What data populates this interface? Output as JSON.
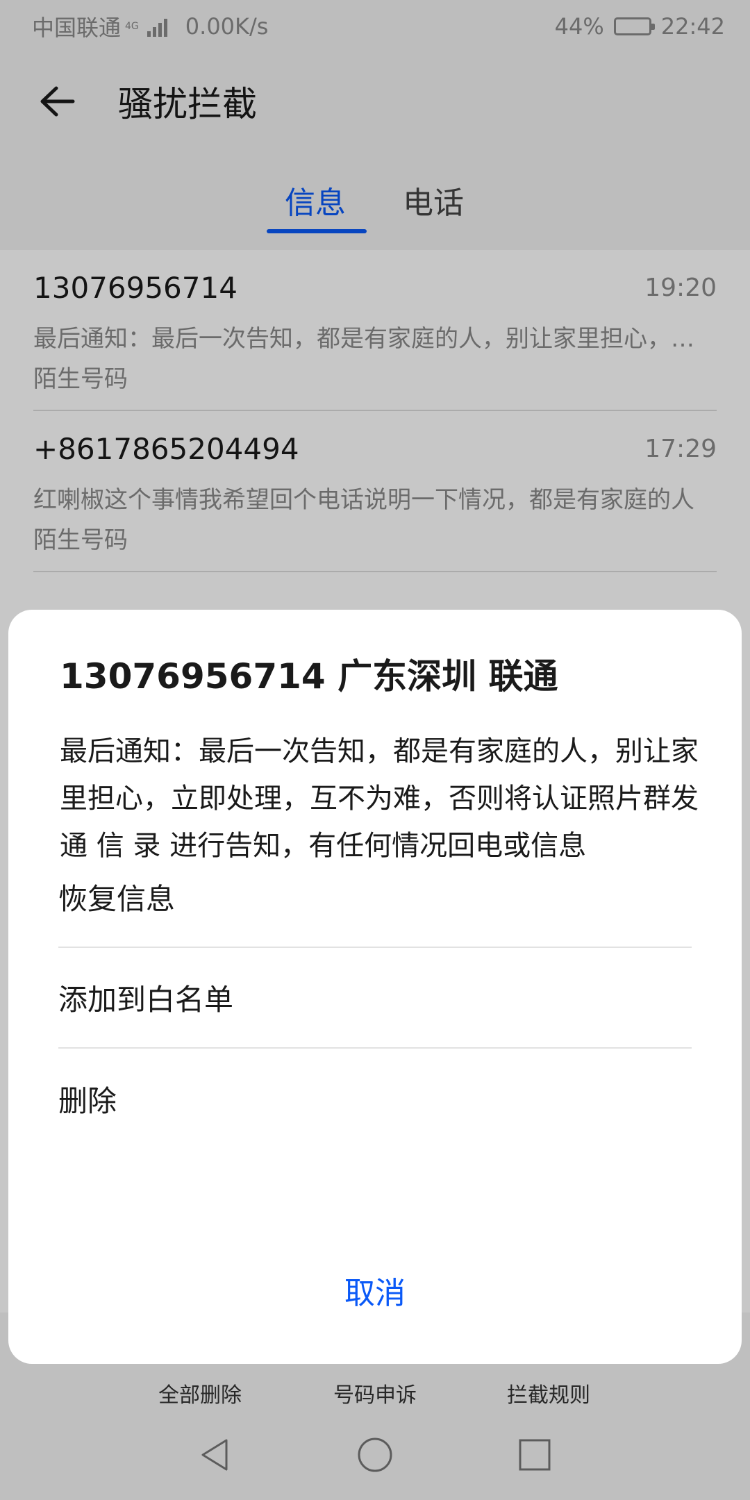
{
  "status_bar": {
    "carrier": "中国联通",
    "network": "4G",
    "speed": "0.00K/s",
    "battery": "44%",
    "battery_level": 0.44,
    "time": "22:42"
  },
  "app_bar": {
    "title": "骚扰拦截"
  },
  "tabs": [
    {
      "label": "信息",
      "selected": true
    },
    {
      "label": "电话",
      "selected": false
    }
  ],
  "messages": [
    {
      "number": "13076956714",
      "time": "19:20",
      "preview": "最后通知：最后一次告知，都是有家庭的人，别让家里担心，立即处理，互不为难",
      "tag": "陌生号码"
    },
    {
      "number": "+8617865204494",
      "time": "17:29",
      "preview": "红喇椒这个事情我希望回个电话说明一下情况，都是有家庭的人",
      "tag": "陌生号码"
    }
  ],
  "bottom_nav": [
    {
      "label": "全部删除",
      "icon": "trash-icon"
    },
    {
      "label": "号码申诉",
      "icon": "appeal-icon"
    },
    {
      "label": "拦截规则",
      "icon": "rules-icon"
    }
  ],
  "dialog": {
    "title": "13076956714 广东深圳 联通",
    "body": "最后通知：最后一次告知，都是有家庭的人，别让家里担心，立即处理，互不为难，否则将认证照片群发通 信 录 进行告知，有任何情况回电或信息",
    "options": [
      "恢复信息",
      "添加到白名单",
      "删除"
    ],
    "cancel": "取消"
  },
  "colors": {
    "accent": "#0a59f7",
    "muted_text": "#8a8a8a"
  }
}
